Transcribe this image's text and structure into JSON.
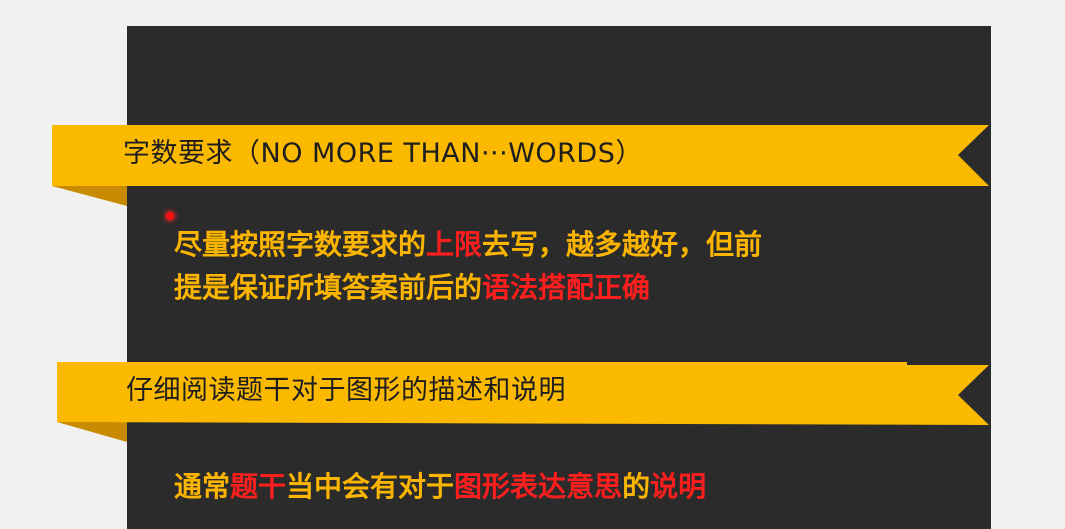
{
  "ribbon1": {
    "text": "字数要求（NO MORE THAN···WORDS）"
  },
  "block1": {
    "line1": {
      "a": "尽量按照字数要求的",
      "b": "上限",
      "c": "去写，越多越好，但前"
    },
    "line2": {
      "a": "提是保证所填答案前后的",
      "b": "语法搭配正确"
    }
  },
  "ribbon2": {
    "text": "仔细阅读题干对于图形的描述和说明"
  },
  "block2": {
    "line1": {
      "a": "通常",
      "b": "题干",
      "c": "当中会有对于",
      "d": "图形表达意思",
      "e": "的",
      "f": "说明"
    }
  },
  "colors": {
    "ribbon": "#fbb900",
    "ribbon_shadow": "#c88a00",
    "panel": "#2b2b2b",
    "text_yellow": "#fbb500",
    "text_red": "#ff1e1e"
  }
}
